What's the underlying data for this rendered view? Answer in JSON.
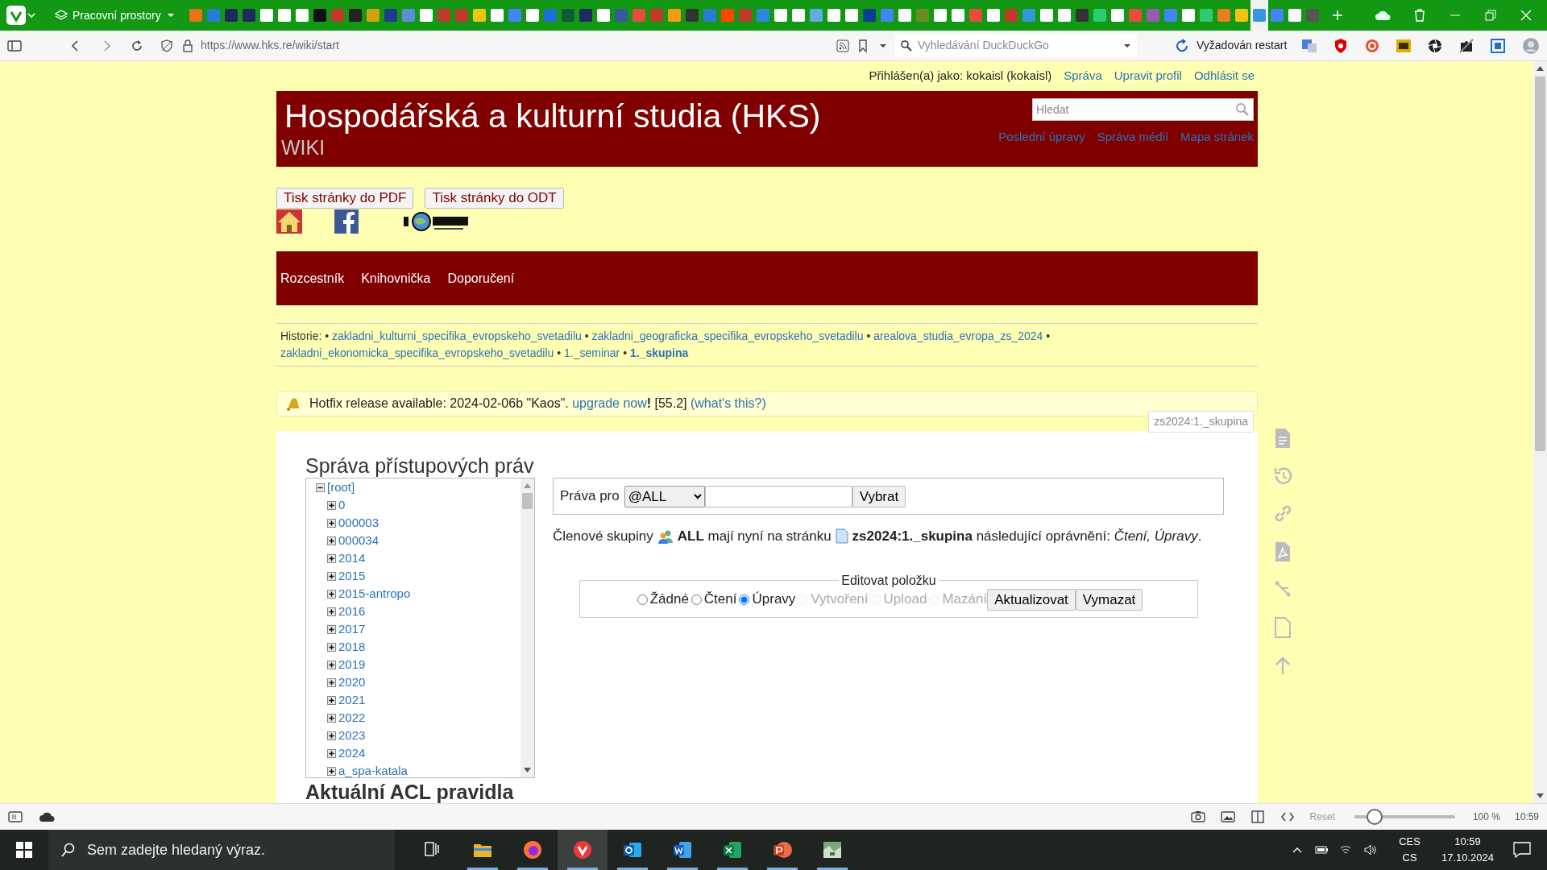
{
  "browser": {
    "workspace": "Pracovní prostory",
    "tabs": [
      {
        "color": "#e8731a",
        "selected": false
      },
      {
        "color": "#2a7bd4",
        "selected": false
      },
      {
        "color": "#1d2b5c",
        "selected": false
      },
      {
        "color": "#1d2b5c",
        "selected": false
      },
      {
        "color": "#ffffff",
        "selected": false
      },
      {
        "color": "#ffffff",
        "selected": false
      },
      {
        "color": "#ffffff",
        "selected": false
      },
      {
        "color": "#111111",
        "selected": false
      },
      {
        "color": "#c0392b",
        "selected": false
      },
      {
        "color": "#222222",
        "selected": false
      },
      {
        "color": "#d4a017",
        "selected": false
      },
      {
        "color": "#1a3d8f",
        "selected": false
      },
      {
        "color": "#5a8fd8",
        "selected": false
      },
      {
        "color": "#ffffff",
        "selected": false
      },
      {
        "color": "#c0392b",
        "selected": false
      },
      {
        "color": "#c0392b",
        "selected": false
      },
      {
        "color": "#f1c40f",
        "selected": false
      },
      {
        "color": "#ffffff",
        "selected": false
      },
      {
        "color": "#4285f4",
        "selected": false
      },
      {
        "color": "#ffffff",
        "selected": false
      },
      {
        "color": "#1e6fd9",
        "selected": false
      },
      {
        "color": "#0a5c36",
        "selected": false
      },
      {
        "color": "#1d2b5c",
        "selected": false
      },
      {
        "color": "#ffffff",
        "selected": false
      },
      {
        "color": "#3b5998",
        "selected": false
      },
      {
        "color": "#e84c3d",
        "selected": false
      },
      {
        "color": "#c0392b",
        "selected": false
      },
      {
        "color": "#f39c12",
        "selected": false
      },
      {
        "color": "#333333",
        "selected": false
      },
      {
        "color": "#2a7bd4",
        "selected": false
      },
      {
        "color": "#ff4500",
        "selected": false
      },
      {
        "color": "#c0392b",
        "selected": false
      },
      {
        "color": "#2e86de",
        "selected": false
      },
      {
        "color": "#ffffff",
        "selected": false
      },
      {
        "color": "#ffffff",
        "selected": false
      },
      {
        "color": "#5dade2",
        "selected": false
      },
      {
        "color": "#ffffff",
        "selected": false
      },
      {
        "color": "#ffffff",
        "selected": false
      },
      {
        "color": "#0b3d91",
        "selected": false
      },
      {
        "color": "#4285f4",
        "selected": false
      },
      {
        "color": "#ffffff",
        "selected": false
      },
      {
        "color": "#6b8e23",
        "selected": false
      },
      {
        "color": "#ffffff",
        "selected": false
      },
      {
        "color": "#ffffff",
        "selected": false
      },
      {
        "color": "#e74c3c",
        "selected": false
      },
      {
        "color": "#ffffff",
        "selected": false
      },
      {
        "color": "#c0392b",
        "selected": false
      },
      {
        "color": "#3498db",
        "selected": false
      },
      {
        "color": "#ffffff",
        "selected": false
      },
      {
        "color": "#ffffff",
        "selected": false
      },
      {
        "color": "#333333",
        "selected": false
      },
      {
        "color": "#2ecc71",
        "selected": false
      },
      {
        "color": "#ffffff",
        "selected": false
      },
      {
        "color": "#e74c3c",
        "selected": false
      },
      {
        "color": "#9b59b6",
        "selected": false
      },
      {
        "color": "#4285f4",
        "selected": false
      },
      {
        "color": "#ffffff",
        "selected": false
      },
      {
        "color": "#2ecc71",
        "selected": false
      },
      {
        "color": "#e67e22",
        "selected": false
      },
      {
        "color": "#f1c40f",
        "selected": false
      },
      {
        "color": "#3498db",
        "selected": true
      },
      {
        "color": "#4285f4",
        "selected": false
      },
      {
        "color": "#ffffff",
        "selected": false
      },
      {
        "color": "#555555",
        "selected": false
      }
    ],
    "url": "https://www.hks.re/wiki/start",
    "search": {
      "placeholder": "Vyhledávání DuckDuckGo"
    },
    "restart": "Vyžadován restart"
  },
  "page": {
    "user_bar": {
      "label": "Přihlášen(a) jako: kokaisl (kokaisl)",
      "links": [
        "Správa",
        "Upravit profil",
        "Odhlásit se"
      ]
    },
    "header": {
      "title": "Hospodářská a kulturní studia (HKS)",
      "subtitle": "WIKI",
      "search": {
        "placeholder": "Hledat"
      },
      "links": [
        "Poslední úpravy",
        "Správa médií",
        "Mapa stránek"
      ]
    },
    "print_buttons": [
      "Tisk stránky do PDF",
      "Tisk stránky do ODT"
    ],
    "nav": [
      "Rozcestník",
      "Knihovnička",
      "Doporučení"
    ],
    "breadcrumbs": {
      "label": "Historie:",
      "separator": "•",
      "items": [
        {
          "text": "zakladni_kulturni_specifika_evropskeho_svetadilu",
          "current": false
        },
        {
          "text": "zakladni_geograficka_specifika_evropskeho_svetadilu",
          "current": false
        },
        {
          "text": "arealova_studia_evropa_zs_2024",
          "current": false
        },
        {
          "text": "zakladni_ekonomicka_specifika_evropskeho_svetadilu",
          "current": false
        },
        {
          "text": "1._seminar",
          "current": false
        },
        {
          "text": "1._skupina",
          "current": true
        }
      ]
    },
    "hotfix": {
      "text": "Hotfix release available: 2024-02-06b \"Kaos\".",
      "link": "upgrade now",
      "mark": "!",
      "version": "[55.2]",
      "help": "(what's this?)"
    },
    "page_id": "zs2024:1._skupina",
    "acl": {
      "heading": "Správa přístupových práv",
      "tree": {
        "label": "[root]",
        "expanded": true,
        "children": [
          {
            "label": "0",
            "expanded": false
          },
          {
            "label": "000003",
            "expanded": false
          },
          {
            "label": "000034",
            "expanded": false
          },
          {
            "label": "2014",
            "expanded": false
          },
          {
            "label": "2015",
            "expanded": false
          },
          {
            "label": "2015-antropo",
            "expanded": false
          },
          {
            "label": "2016",
            "expanded": false
          },
          {
            "label": "2017",
            "expanded": false
          },
          {
            "label": "2018",
            "expanded": false
          },
          {
            "label": "2019",
            "expanded": false
          },
          {
            "label": "2020",
            "expanded": false
          },
          {
            "label": "2021",
            "expanded": false
          },
          {
            "label": "2022",
            "expanded": false
          },
          {
            "label": "2023",
            "expanded": false
          },
          {
            "label": "2024",
            "expanded": false
          },
          {
            "label": "a_spa-katala",
            "expanded": false
          }
        ]
      },
      "form": {
        "label": "Práva pro",
        "select": "@ALL",
        "button": "Vybrat"
      },
      "info": [
        "Členové skupiny",
        "**ALL** mají nyní na stránku",
        "**zs2024:1._skupina** následující oprávnění: *Čtení, Úpravy*."
      ],
      "edit": {
        "legend": "Editovat položku",
        "options": [
          {
            "label": "Žádné",
            "selected": false,
            "disabled": false
          },
          {
            "label": "Čtení",
            "selected": false,
            "disabled": false
          },
          {
            "label": "Úpravy",
            "selected": true,
            "disabled": false
          },
          {
            "label": "Vytvoření",
            "selected": false,
            "disabled": true
          },
          {
            "label": "Upload",
            "selected": false,
            "disabled": true
          },
          {
            "label": "Mazání",
            "selected": false,
            "disabled": true
          }
        ],
        "buttons": [
          "Aktualizovat",
          "Vymazat"
        ]
      },
      "rules_heading": "Aktuální ACL pravidla"
    }
  },
  "status_bar": {
    "reset": "Reset",
    "zoom": {
      "level": 0.2
    },
    "zoom_text": "100 %",
    "time": "10:59"
  },
  "taskbar": {
    "search": {
      "placeholder": "Sem zadejte hledaný výraz."
    },
    "lang": [
      "CES",
      "CS"
    ],
    "time": "10:59",
    "date": "17.10.2024"
  }
}
